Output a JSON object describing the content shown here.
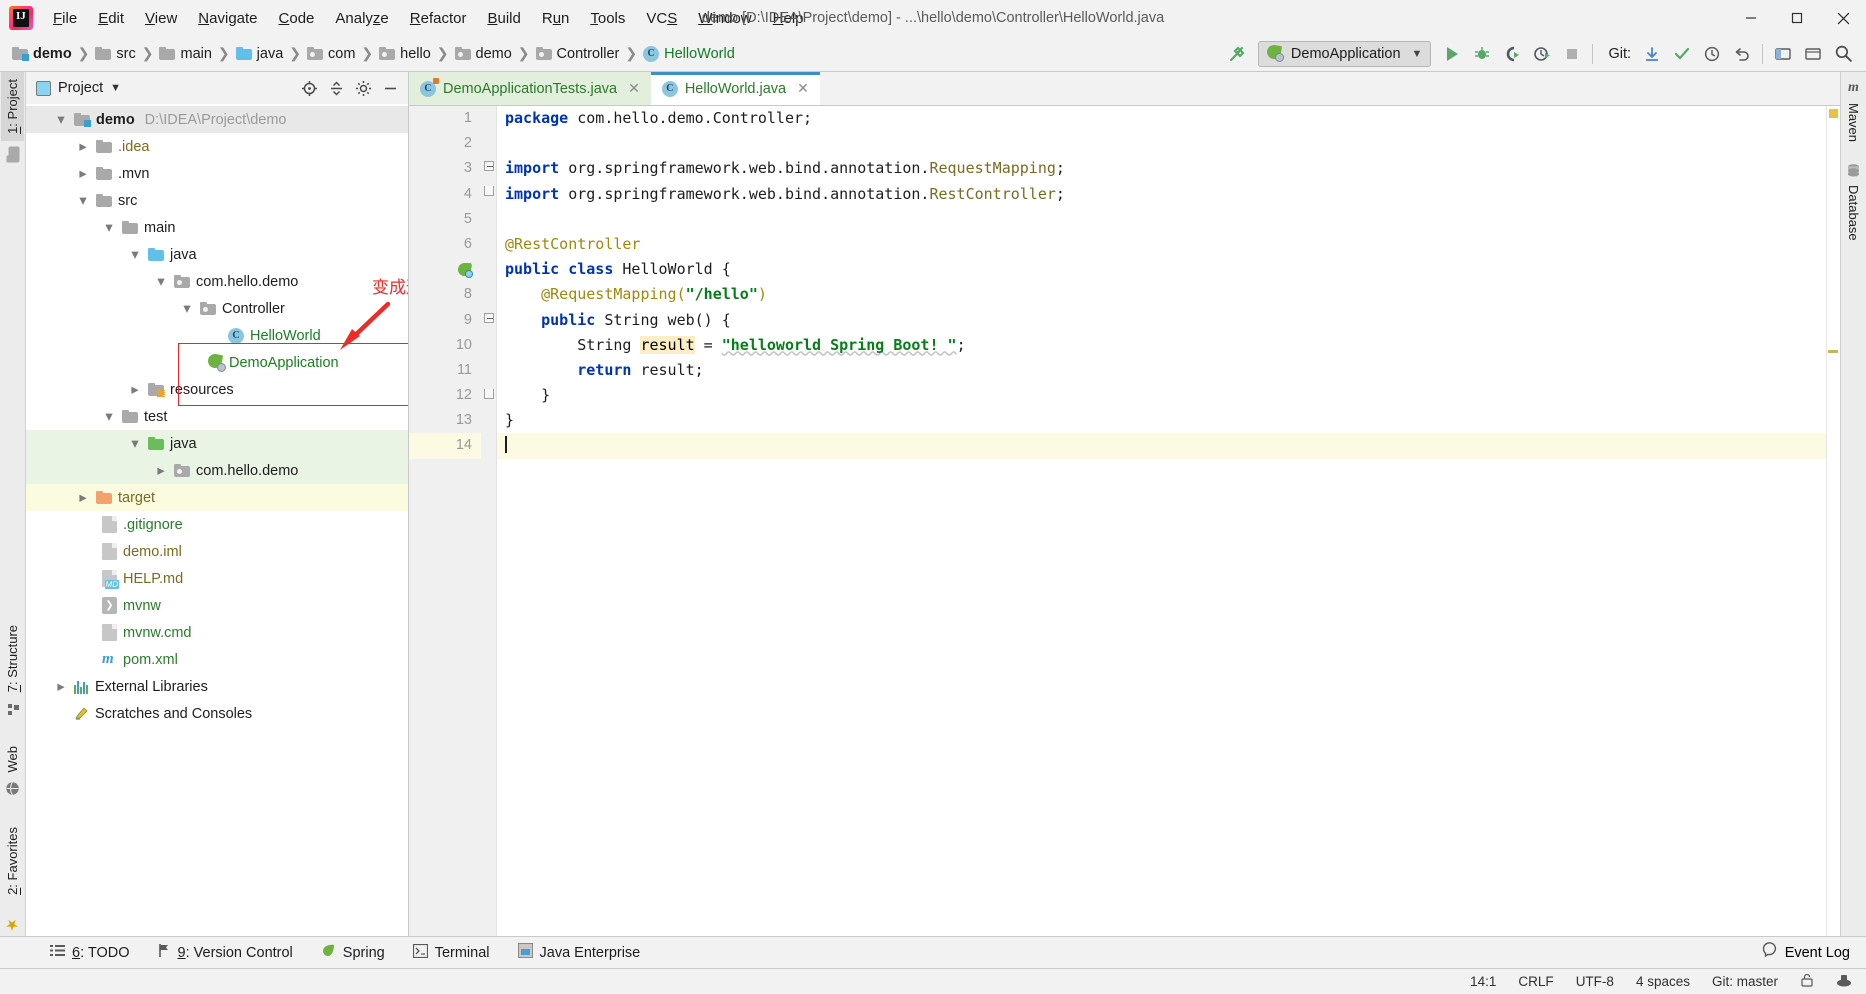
{
  "window": {
    "title": "demo [D:\\IDEA\\Project\\demo] - ...\\hello\\demo\\Controller\\HelloWorld.java",
    "logo_name": "intellij-idea-logo",
    "minimize": "—",
    "maximize": "☐",
    "close": "✕"
  },
  "menubar": [
    {
      "label": "File",
      "mnemonic": "F"
    },
    {
      "label": "Edit",
      "mnemonic": "E"
    },
    {
      "label": "View",
      "mnemonic": "V"
    },
    {
      "label": "Navigate",
      "mnemonic": "N"
    },
    {
      "label": "Code",
      "mnemonic": "C"
    },
    {
      "label": "Analyze",
      "mnemonic": "z"
    },
    {
      "label": "Refactor",
      "mnemonic": "R"
    },
    {
      "label": "Build",
      "mnemonic": "B"
    },
    {
      "label": "Run",
      "mnemonic": "u"
    },
    {
      "label": "Tools",
      "mnemonic": "T"
    },
    {
      "label": "VCS",
      "mnemonic": "S"
    },
    {
      "label": "Window",
      "mnemonic": "W"
    },
    {
      "label": "Help",
      "mnemonic": "H"
    }
  ],
  "breadcrumbs": [
    {
      "label": "demo",
      "icon": "folder-module-icon",
      "style": "bold"
    },
    {
      "label": "src",
      "icon": "folder-icon",
      "style": "normal"
    },
    {
      "label": "main",
      "icon": "folder-icon",
      "style": "normal"
    },
    {
      "label": "java",
      "icon": "folder-source-icon",
      "style": "normal"
    },
    {
      "label": "com",
      "icon": "folder-package-icon",
      "style": "normal"
    },
    {
      "label": "hello",
      "icon": "folder-package-icon",
      "style": "normal"
    },
    {
      "label": "demo",
      "icon": "folder-package-icon",
      "style": "normal"
    },
    {
      "label": "Controller",
      "icon": "folder-package-icon",
      "style": "normal"
    },
    {
      "label": "HelloWorld",
      "icon": "class-icon",
      "style": "green"
    }
  ],
  "toolbar": {
    "build_icon": "hammer-icon",
    "run_config": {
      "label": "DemoApplication",
      "icon": "spring-boot-icon",
      "chevron": "∨"
    },
    "run_button": "run-icon",
    "debug_button": "debug-icon",
    "run_coverage_button": "run-with-coverage-icon",
    "profile_button": "profiler-icon",
    "stop_button": "stop-icon",
    "git_label": "Git:",
    "git_actions": [
      "update-project-icon",
      "commit-icon",
      "history-icon",
      "rollback-icon"
    ],
    "right_actions": [
      "select-in-icon",
      "settings-icon",
      "search-icon"
    ]
  },
  "left_strip": [
    {
      "label": "1: Project",
      "mnemonic": "1",
      "icon": "project-icon",
      "active": true
    },
    {
      "label": "7: Structure",
      "mnemonic": "7",
      "icon": "structure-icon",
      "active": false
    },
    {
      "label": "Web",
      "mnemonic": "",
      "icon": "web-icon",
      "active": false
    },
    {
      "label": "2: Favorites",
      "mnemonic": "2",
      "icon": "favorites-icon",
      "active": false
    }
  ],
  "right_strip": [
    {
      "label": "Maven",
      "icon": "maven-icon"
    },
    {
      "label": "Database",
      "icon": "database-icon"
    }
  ],
  "project_panel": {
    "title": "Project",
    "chevron": "▾",
    "actions": [
      "locate-icon",
      "collapse-all-icon",
      "settings-icon",
      "hide-icon"
    ],
    "tree": [
      {
        "label": "demo",
        "path": "D:\\IDEA\\Project\\demo",
        "indent": 0,
        "arrow": "down",
        "icon": "folder-module-icon",
        "color": "black",
        "bold": true,
        "bg": "sel-grey"
      },
      {
        "label": ".idea",
        "indent": 1,
        "arrow": "right",
        "icon": "folder-icon",
        "color": "olive"
      },
      {
        "label": ".mvn",
        "indent": 1,
        "arrow": "right",
        "icon": "folder-icon",
        "color": "black"
      },
      {
        "label": "src",
        "indent": 1,
        "arrow": "down",
        "icon": "folder-icon",
        "color": "black"
      },
      {
        "label": "main",
        "indent": 2,
        "arrow": "down",
        "icon": "folder-icon",
        "color": "black"
      },
      {
        "label": "java",
        "indent": 3,
        "arrow": "down",
        "icon": "folder-source-icon",
        "color": "black"
      },
      {
        "label": "com.hello.demo",
        "indent": 4,
        "arrow": "down",
        "icon": "folder-package-icon",
        "color": "black"
      },
      {
        "label": "Controller",
        "indent": 5,
        "arrow": "down",
        "icon": "folder-package-icon",
        "color": "black"
      },
      {
        "label": "HelloWorld",
        "indent": 7,
        "arrow": "none",
        "icon": "class-icon",
        "color": "green"
      },
      {
        "label": "DemoApplication",
        "indent": 6,
        "arrow": "none",
        "icon": "spring-class-icon",
        "color": "green"
      },
      {
        "label": "resources",
        "indent": 3,
        "arrow": "right",
        "icon": "folder-resources-icon",
        "color": "black"
      },
      {
        "label": "test",
        "indent": 2,
        "arrow": "down",
        "icon": "folder-icon",
        "color": "black"
      },
      {
        "label": "java",
        "indent": 3,
        "arrow": "down",
        "icon": "folder-test-source-icon",
        "color": "black",
        "bg": "hl-green"
      },
      {
        "label": "com.hello.demo",
        "indent": 4,
        "arrow": "right",
        "icon": "folder-package-icon",
        "color": "black",
        "bg": "hl-green"
      },
      {
        "label": "target",
        "indent": 1,
        "arrow": "right",
        "icon": "folder-excluded-icon",
        "color": "olive",
        "bg": "hl-yellow"
      },
      {
        "label": ".gitignore",
        "indent": 2,
        "arrow": "none",
        "icon": "gitignore-file-icon",
        "color": "dgreen"
      },
      {
        "label": "demo.iml",
        "indent": 2,
        "arrow": "none",
        "icon": "iml-file-icon",
        "color": "olive"
      },
      {
        "label": "HELP.md",
        "indent": 2,
        "arrow": "none",
        "icon": "markdown-file-icon",
        "color": "olive"
      },
      {
        "label": "mvnw",
        "indent": 2,
        "arrow": "none",
        "icon": "script-file-icon",
        "color": "dgreen"
      },
      {
        "label": "mvnw.cmd",
        "indent": 2,
        "arrow": "none",
        "icon": "cmd-file-icon",
        "color": "dgreen"
      },
      {
        "label": "pom.xml",
        "indent": 2,
        "arrow": "none",
        "icon": "maven-pom-icon",
        "color": "dgreen"
      },
      {
        "label": "External Libraries",
        "indent": 0,
        "arrow": "right",
        "icon": "external-libraries-icon",
        "color": "black"
      },
      {
        "label": "Scratches and Consoles",
        "indent": 0,
        "arrow": "none",
        "icon": "scratches-icon",
        "color": "black"
      }
    ]
  },
  "annotation": {
    "text": "变成这种颜色",
    "color": "#ef2b2b",
    "shapes": [
      "red-rectangle-highlight",
      "red-arrow"
    ]
  },
  "editor": {
    "tabs": [
      {
        "label": "DemoApplicationTests.java",
        "icon": "test-class-icon",
        "active": false,
        "close": "✕"
      },
      {
        "label": "HelloWorld.java",
        "icon": "class-icon",
        "active": true,
        "close": "✕"
      }
    ],
    "lines": [
      {
        "n": "1",
        "tokens": [
          {
            "t": "package ",
            "c": "kw"
          },
          {
            "t": "com.hello.demo.Controller;",
            "c": "pl"
          }
        ]
      },
      {
        "n": "2",
        "tokens": []
      },
      {
        "n": "3",
        "tokens": [
          {
            "t": "import ",
            "c": "kw"
          },
          {
            "t": "org.springframework.web.bind.annotation.",
            "c": "pl"
          },
          {
            "t": "RequestMapping",
            "c": "typ"
          },
          {
            "t": ";",
            "c": "pl"
          }
        ],
        "fold": "start"
      },
      {
        "n": "4",
        "tokens": [
          {
            "t": "import ",
            "c": "kw"
          },
          {
            "t": "org.springframework.web.bind.annotation.",
            "c": "pl"
          },
          {
            "t": "RestController",
            "c": "typ"
          },
          {
            "t": ";",
            "c": "pl"
          }
        ],
        "fold": "end"
      },
      {
        "n": "5",
        "tokens": []
      },
      {
        "n": "6",
        "tokens": [
          {
            "t": "@RestController",
            "c": "anno"
          }
        ]
      },
      {
        "n": "7",
        "tokens": [
          {
            "t": "public class ",
            "c": "kw"
          },
          {
            "t": "HelloWorld {",
            "c": "pl"
          }
        ],
        "runmark": true
      },
      {
        "n": "8",
        "tokens": [
          {
            "t": "    @RequestMapping(",
            "c": "anno"
          },
          {
            "t": "\"/hello\"",
            "c": "str"
          },
          {
            "t": ")",
            "c": "anno"
          }
        ]
      },
      {
        "n": "9",
        "tokens": [
          {
            "t": "    public ",
            "c": "kw"
          },
          {
            "t": "String web() {",
            "c": "pl"
          }
        ],
        "fold": "start"
      },
      {
        "n": "10",
        "tokens": [
          {
            "t": "        String ",
            "c": "pl"
          },
          {
            "t": "result",
            "c": "hl"
          },
          {
            "t": " = ",
            "c": "pl"
          },
          {
            "t": "\"helloworld Spring Boot! \"",
            "c": "str"
          },
          {
            "t": ";",
            "c": "pl"
          }
        ]
      },
      {
        "n": "11",
        "tokens": [
          {
            "t": "        return ",
            "c": "kw"
          },
          {
            "t": "result;",
            "c": "pl"
          }
        ]
      },
      {
        "n": "12",
        "tokens": [
          {
            "t": "    }",
            "c": "pl"
          }
        ],
        "fold": "end"
      },
      {
        "n": "13",
        "tokens": [
          {
            "t": "}",
            "c": "pl"
          }
        ]
      },
      {
        "n": "14",
        "tokens": [],
        "current": true,
        "caret": true
      }
    ]
  },
  "bottom_bar": {
    "items": [
      {
        "label": "6: TODO",
        "mnemonic": "6",
        "icon": "todo-icon"
      },
      {
        "label": "9: Version Control",
        "mnemonic": "9",
        "icon": "version-control-icon"
      },
      {
        "label": "Spring",
        "mnemonic": "",
        "icon": "spring-icon"
      },
      {
        "label": "Terminal",
        "mnemonic": "",
        "icon": "terminal-icon"
      },
      {
        "label": "Java Enterprise",
        "mnemonic": "",
        "icon": "java-enterprise-icon"
      }
    ],
    "event_log": {
      "label": "Event Log",
      "icon": "event-log-icon"
    }
  },
  "status_bar": {
    "caret_position": "14:1",
    "line_separator": "CRLF",
    "encoding": "UTF-8",
    "indent": "4 spaces",
    "branch": "Git: master",
    "icons": [
      "lock-icon",
      "inspector-icon"
    ]
  }
}
